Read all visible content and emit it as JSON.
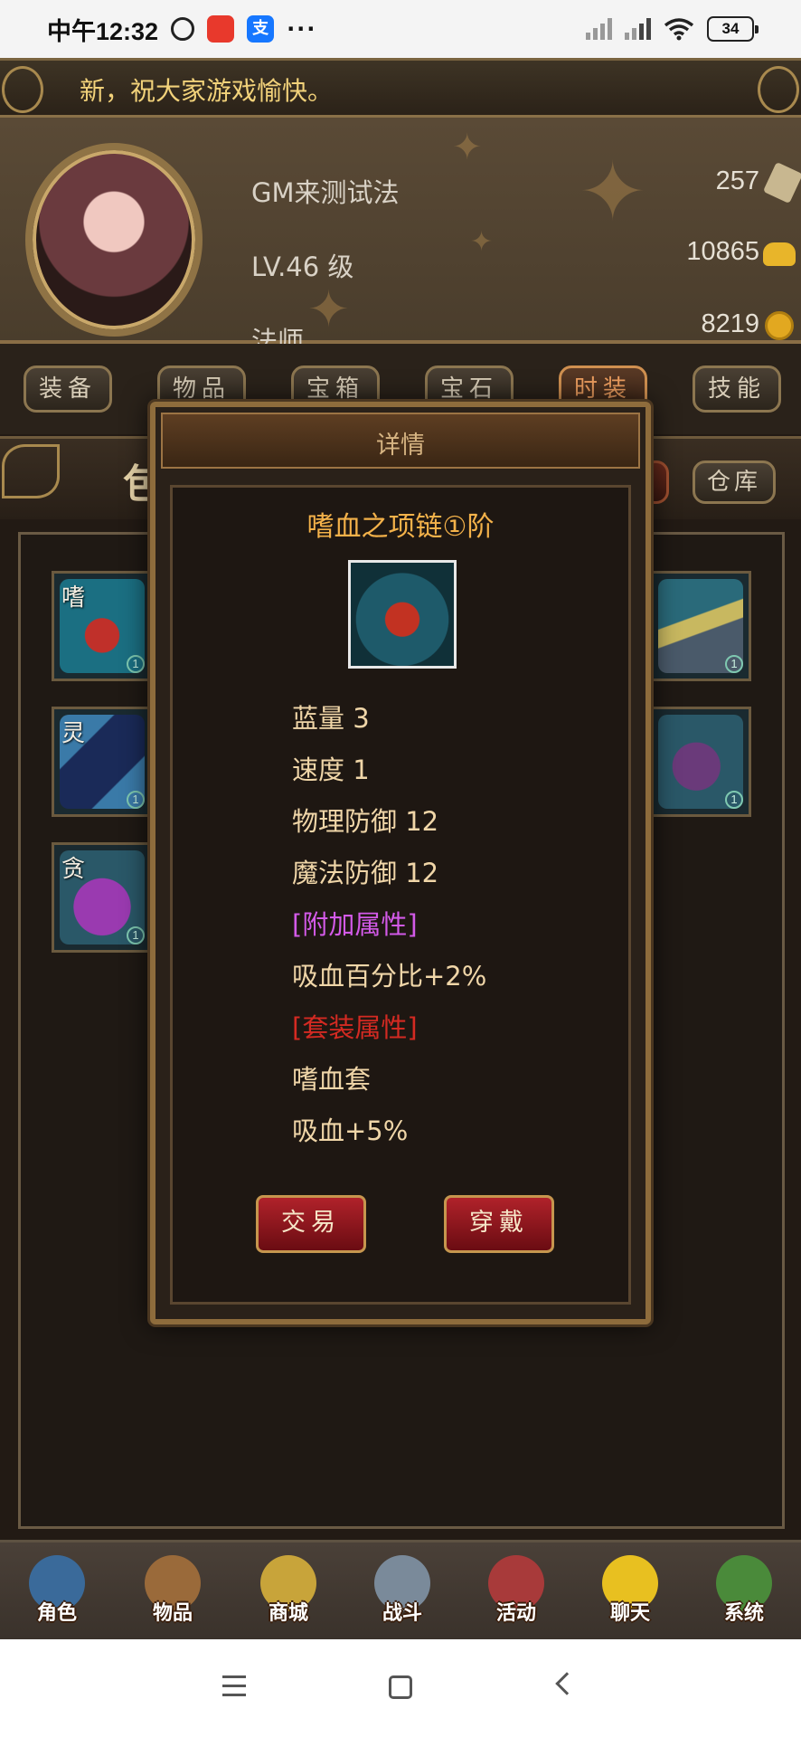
{
  "status_bar": {
    "time": "中午12:32",
    "app_icon_label": "支",
    "more": "···",
    "battery": "34"
  },
  "marquee": {
    "text": "新，祝大家游戏愉快。"
  },
  "player": {
    "name": "GM来测试法",
    "level": "LV.46 级",
    "class": "法师",
    "scrolls": "257",
    "gold": "10865",
    "coins": "8219"
  },
  "tabs": [
    {
      "label": "装备"
    },
    {
      "label": "物品"
    },
    {
      "label": "宝箱"
    },
    {
      "label": "宝石"
    },
    {
      "label": "时装"
    },
    {
      "label": "技能"
    }
  ],
  "bag": {
    "title": "包",
    "warehouse_label": "仓库"
  },
  "slots": [
    {
      "glyph": "嗜",
      "level": "1",
      "art_color": "#1b6f82"
    },
    {
      "glyph": "灵",
      "level": "1",
      "art_color": "#1f5878"
    },
    {
      "glyph": "贪",
      "level": "1",
      "art_color": "#5a2a6a"
    },
    {
      "glyph": "",
      "level": "1",
      "art_color": "#2d5a6a"
    },
    {
      "glyph": "",
      "level": "1",
      "art_color": "#3a2a4a"
    }
  ],
  "modal": {
    "title": "详情",
    "item_name": "嗜血之项链①阶",
    "attributes": [
      {
        "text": "蓝量 3",
        "style": "normal"
      },
      {
        "text": "速度 1",
        "style": "normal"
      },
      {
        "text": "物理防御 12",
        "style": "normal"
      },
      {
        "text": "魔法防御 12",
        "style": "normal"
      },
      {
        "text": "[附加属性]",
        "style": "purple"
      },
      {
        "text": "吸血百分比+2%",
        "style": "normal"
      },
      {
        "text": "[套装属性]",
        "style": "red"
      },
      {
        "text": "嗜血套",
        "style": "normal"
      },
      {
        "text": "吸血+5%",
        "style": "normal"
      }
    ],
    "trade_label": "交易",
    "equip_label": "穿戴"
  },
  "bottom_nav": [
    {
      "label": "角色",
      "icon": "character-icon",
      "color": "#3a6a9a"
    },
    {
      "label": "物品",
      "icon": "items-icon",
      "color": "#9a6a3a"
    },
    {
      "label": "商城",
      "icon": "shop-icon",
      "color": "#c8a43a"
    },
    {
      "label": "战斗",
      "icon": "battle-icon",
      "color": "#7a8a9a"
    },
    {
      "label": "活动",
      "icon": "event-icon",
      "color": "#a83a3a"
    },
    {
      "label": "聊天",
      "icon": "chat-icon",
      "color": "#e8c020"
    },
    {
      "label": "系统",
      "icon": "system-icon",
      "color": "#4a8a3a"
    }
  ]
}
